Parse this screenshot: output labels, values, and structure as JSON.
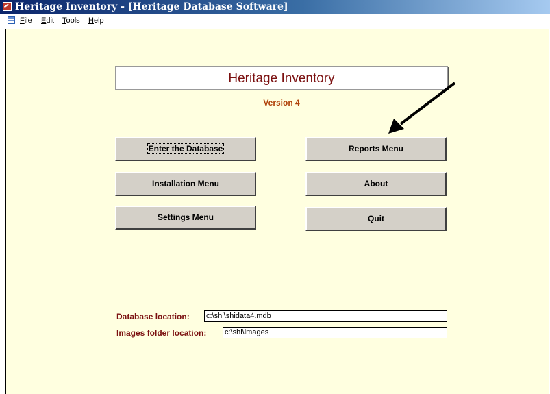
{
  "window": {
    "title": "Heritage Inventory - [Heritage Database Software]"
  },
  "menubar": {
    "items": [
      {
        "label": "File",
        "accel": "F",
        "rest": "ile"
      },
      {
        "label": "Edit",
        "accel": "E",
        "rest": "dit"
      },
      {
        "label": "Tools",
        "accel": "T",
        "rest": "ools"
      },
      {
        "label": "Help",
        "accel": "H",
        "rest": "elp"
      }
    ]
  },
  "header": {
    "title": "Heritage Inventory",
    "version": "Version 4"
  },
  "buttons": {
    "enter_database": "Enter the Database",
    "reports_menu": "Reports Menu",
    "installation_menu": "Installation Menu",
    "about": "About",
    "settings_menu": "Settings Menu",
    "quit": "Quit"
  },
  "fields": {
    "database_location": {
      "label": "Database location:",
      "value": "c:\\shi\\shidata4.mdb"
    },
    "images_folder_location": {
      "label": "Images folder location:",
      "value": "c:\\shi\\images"
    }
  },
  "colors": {
    "title_gradient_start": "#0a246a",
    "form_background": "#ffffe0",
    "heading_text": "#7b1010",
    "version_text": "#b0420a"
  }
}
